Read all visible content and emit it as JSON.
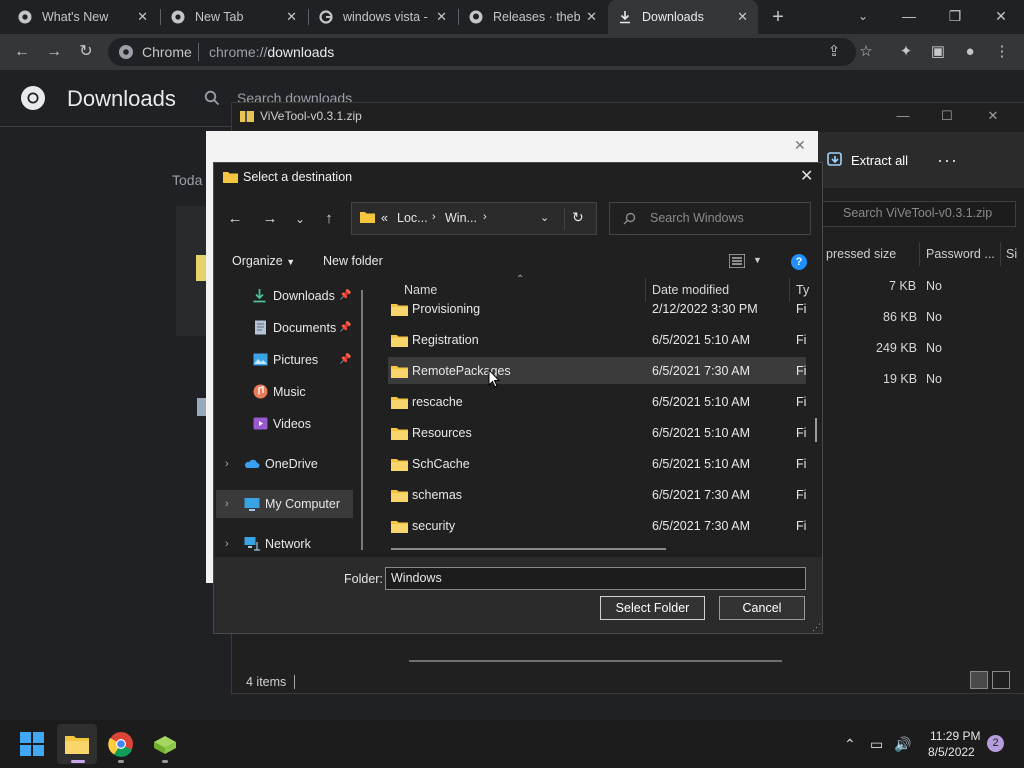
{
  "browser": {
    "tabs": [
      {
        "label": "What's New",
        "icon": "chrome-icon"
      },
      {
        "label": "New Tab",
        "icon": "chrome-icon"
      },
      {
        "label": "windows vista -",
        "icon": "google-icon"
      },
      {
        "label": "Releases · thebo",
        "icon": "github-icon"
      },
      {
        "label": "Downloads",
        "icon": "download-icon",
        "active": true
      }
    ],
    "new_tab_label": "+",
    "omnibox": {
      "site": "Chrome",
      "url_prefix": "chrome://",
      "url_path": "downloads"
    }
  },
  "downloads_page": {
    "title": "Downloads",
    "search_placeholder": "Search downloads",
    "date_group": "Toda"
  },
  "explorer": {
    "title": "ViVeTool-v0.3.1.zip",
    "extract_all": "Extract all",
    "more": "···",
    "search_placeholder": "Search ViVeTool-v0.3.1.zip",
    "columns": {
      "compressed": "pressed size",
      "password": "Password ...",
      "size": "Si"
    },
    "rows": [
      {
        "compressed": "7 KB",
        "password": "No"
      },
      {
        "compressed": "86 KB",
        "password": "No"
      },
      {
        "compressed": "249 KB",
        "password": "No"
      },
      {
        "compressed": "19 KB",
        "password": "No"
      }
    ],
    "status": "4 items"
  },
  "dialog": {
    "title": "Select a destination",
    "breadcrumb": {
      "prefix": "«",
      "seg1": "Loc...",
      "seg2": "Win..."
    },
    "search_placeholder": "Search Windows",
    "organize": "Organize",
    "new_folder": "New folder",
    "help": "?",
    "nav": {
      "downloads": "Downloads",
      "documents": "Documents",
      "pictures": "Pictures",
      "music": "Music",
      "videos": "Videos",
      "onedrive": "OneDrive",
      "mycomputer": "My Computer",
      "network": "Network"
    },
    "columns": {
      "name": "Name",
      "date": "Date modified",
      "type": "Ty"
    },
    "files": [
      {
        "name": "Provisioning",
        "date": "2/12/2022 3:30 PM",
        "type": "Fi"
      },
      {
        "name": "Registration",
        "date": "6/5/2021 5:10 AM",
        "type": "Fi"
      },
      {
        "name": "RemotePackages",
        "date": "6/5/2021 7:30 AM",
        "type": "Fi"
      },
      {
        "name": "rescache",
        "date": "6/5/2021 5:10 AM",
        "type": "Fi"
      },
      {
        "name": "Resources",
        "date": "6/5/2021 5:10 AM",
        "type": "Fi"
      },
      {
        "name": "SchCache",
        "date": "6/5/2021 5:10 AM",
        "type": "Fi"
      },
      {
        "name": "schemas",
        "date": "6/5/2021 7:30 AM",
        "type": "Fi"
      },
      {
        "name": "security",
        "date": "6/5/2021 7:30 AM",
        "type": "Fi"
      }
    ],
    "folder_label": "Folder:",
    "folder_value": "Windows",
    "select_button": "Select Folder",
    "cancel_button": "Cancel"
  },
  "taskbar": {
    "time": "11:29 PM",
    "date": "8/5/2022",
    "notifications": "2"
  },
  "colors": {
    "accent_blue": "#1e90ff",
    "folder_yellow": "#f5c542",
    "selection": "#3b3b3b"
  }
}
